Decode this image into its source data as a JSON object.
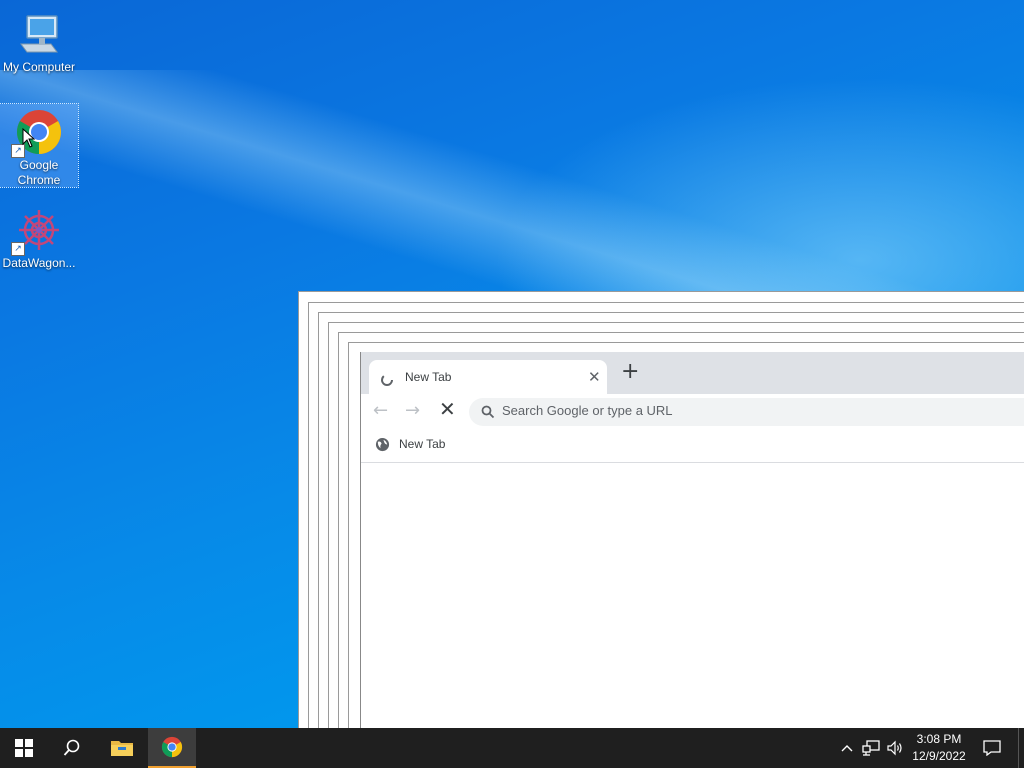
{
  "desktop": {
    "icons": [
      {
        "label": "My Computer",
        "icon": "computer-icon"
      },
      {
        "label": "Google Chrome",
        "icon": "chrome-icon",
        "selected": true
      },
      {
        "label": "DataWagon...",
        "icon": "datawagon-icon"
      }
    ]
  },
  "browser": {
    "tab_title": "New Tab",
    "omnibox_placeholder": "Search Google or type a URL",
    "bookmark_label": "New Tab"
  },
  "taskbar": {
    "time": "3:08 PM",
    "date": "12/9/2022",
    "items": [
      "start-icon",
      "search-icon",
      "file-explorer-icon",
      "chrome-icon"
    ],
    "accent_color": "#f0a030"
  }
}
